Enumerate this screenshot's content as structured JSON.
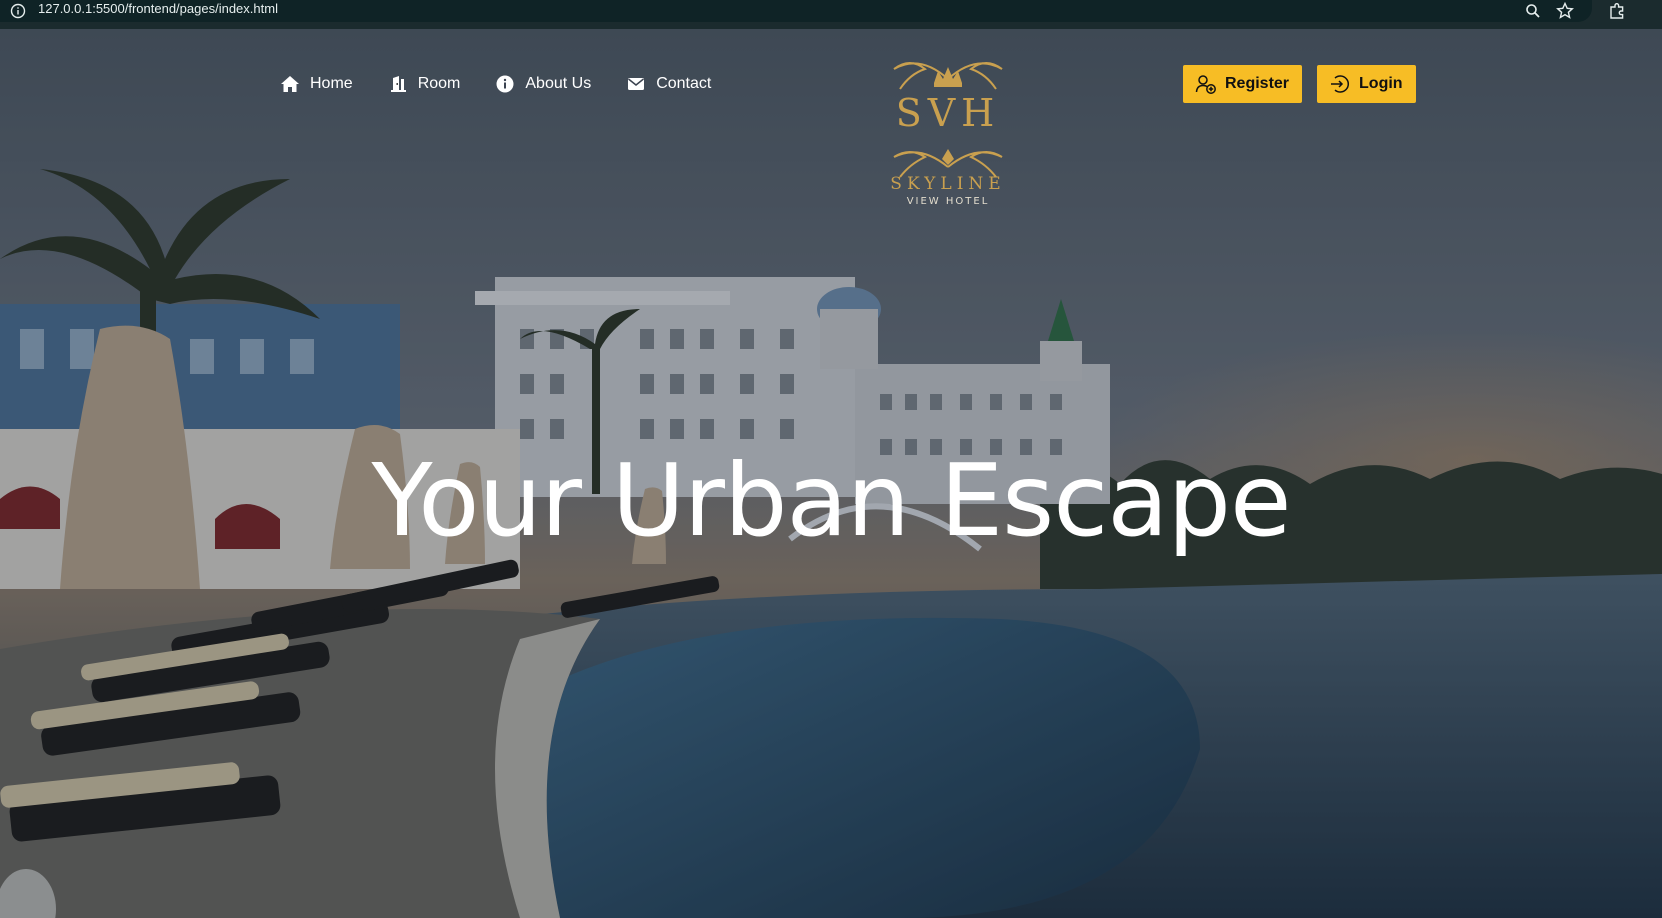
{
  "browser": {
    "url": "127.0.0.1:5500/frontend/pages/index.html",
    "icons": [
      "info-icon",
      "zoom-icon",
      "bookmark-star-icon",
      "extensions-icon"
    ]
  },
  "nav": {
    "items": [
      {
        "label": "Home",
        "icon": "home-icon"
      },
      {
        "label": "Room",
        "icon": "door-icon"
      },
      {
        "label": "About Us",
        "icon": "info-circle-icon"
      },
      {
        "label": "Contact",
        "icon": "envelope-icon"
      }
    ]
  },
  "logo": {
    "monogram": "SVH",
    "name": "SKYLINE",
    "subtitle": "VIEW HOTEL"
  },
  "auth": {
    "register_label": "Register",
    "login_label": "Login"
  },
  "hero": {
    "headline": "Your Urban Escape"
  },
  "colors": {
    "accent": "#f7bd25",
    "logo_gold": "#c9a04f",
    "chrome": "#1b2b2e"
  }
}
